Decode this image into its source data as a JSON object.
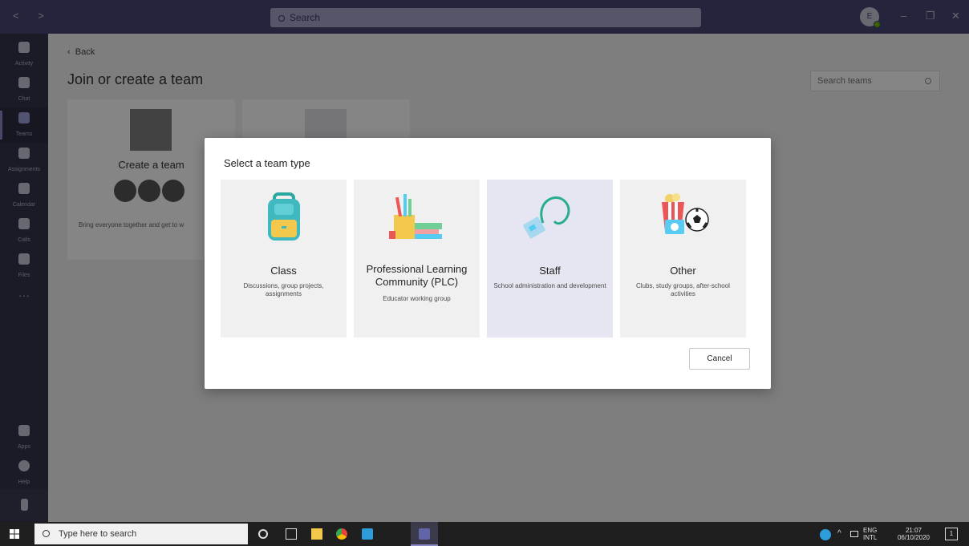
{
  "titlebar": {
    "search_placeholder": "Search",
    "avatar_initial": "E",
    "nav_arrows": "< >",
    "minimize": "–",
    "restore": "❐",
    "close": "✕"
  },
  "rail": {
    "items": [
      {
        "label": "Activity",
        "icon": "bell-icon"
      },
      {
        "label": "Chat",
        "icon": "chat-icon"
      },
      {
        "label": "Teams",
        "icon": "teams-icon"
      },
      {
        "label": "Assignments",
        "icon": "assignments-icon"
      },
      {
        "label": "Calendar",
        "icon": "calendar-icon"
      },
      {
        "label": "Calls",
        "icon": "phone-icon"
      },
      {
        "label": "Files",
        "icon": "files-icon"
      },
      {
        "label": "···",
        "icon": "more-icon"
      }
    ],
    "bottom": [
      {
        "label": "Apps",
        "icon": "apps-icon"
      },
      {
        "label": "Help",
        "icon": "help-icon"
      }
    ]
  },
  "main": {
    "back_label": "Back",
    "heading": "Join or create a team",
    "search_teams_placeholder": "Search teams",
    "create_card": {
      "title": "Create a team",
      "description": "Bring everyone together and get to w"
    }
  },
  "modal": {
    "title": "Select a team type",
    "tiles": [
      {
        "title": "Class",
        "subtitle": "Discussions, group projects, assignments"
      },
      {
        "title": "Professional Learning Community (PLC)",
        "subtitle": "Educator working group"
      },
      {
        "title": "Staff",
        "subtitle": "School administration and development"
      },
      {
        "title": "Other",
        "subtitle": "Clubs, study groups, after-school activities"
      }
    ],
    "cancel_label": "Cancel"
  },
  "taskbar": {
    "search_placeholder": "Type here to search",
    "lang_top": "ENG",
    "lang_bottom": "INTL",
    "time": "21:07",
    "date": "06/10/2020",
    "notification_count": "1"
  },
  "colors": {
    "titlebar": "#464775",
    "rail": "#33344a",
    "accent": "#6264a7"
  }
}
